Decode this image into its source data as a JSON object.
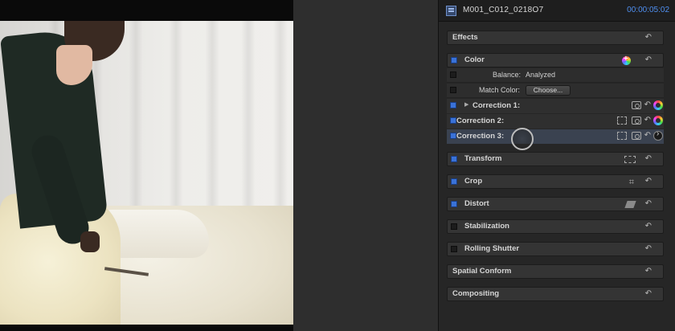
{
  "header": {
    "clip_name": "M001_C012_0218O7",
    "duration": "00:00:05:02",
    "clip_icon": "clip-icon"
  },
  "effects": {
    "label": "Effects",
    "reset_icon": "reset-arrow-icon"
  },
  "color": {
    "label": "Color",
    "enabled": true,
    "balance_label": "Balance:",
    "balance_value": "Analyzed",
    "match_color_label": "Match Color:",
    "choose_button": "Choose...",
    "corrections": [
      {
        "label": "Correction 1:",
        "expanded": false,
        "selected": false
      },
      {
        "label": "Correction 2:",
        "selected": false
      },
      {
        "label": "Correction 3:",
        "selected": true
      }
    ]
  },
  "sections": [
    {
      "label": "Transform",
      "enabled": true,
      "icon": "transform-icon"
    },
    {
      "label": "Crop",
      "enabled": true,
      "icon": "crop-icon"
    },
    {
      "label": "Distort",
      "enabled": true,
      "icon": "distort-icon"
    },
    {
      "label": "Stabilization",
      "enabled": false
    },
    {
      "label": "Rolling Shutter",
      "enabled": false
    },
    {
      "label": "Spatial Conform",
      "no_checkbox": true
    },
    {
      "label": "Compositing",
      "no_checkbox": true
    }
  ],
  "reset_glyph": "↶",
  "disclosure_glyph": "▶",
  "crop_glyph": "⌗",
  "colors": {
    "accent_blue": "#3a72d8",
    "duration_blue": "#4f8ff0",
    "panel_bg": "#262626",
    "selected_row": "#3a4250"
  }
}
